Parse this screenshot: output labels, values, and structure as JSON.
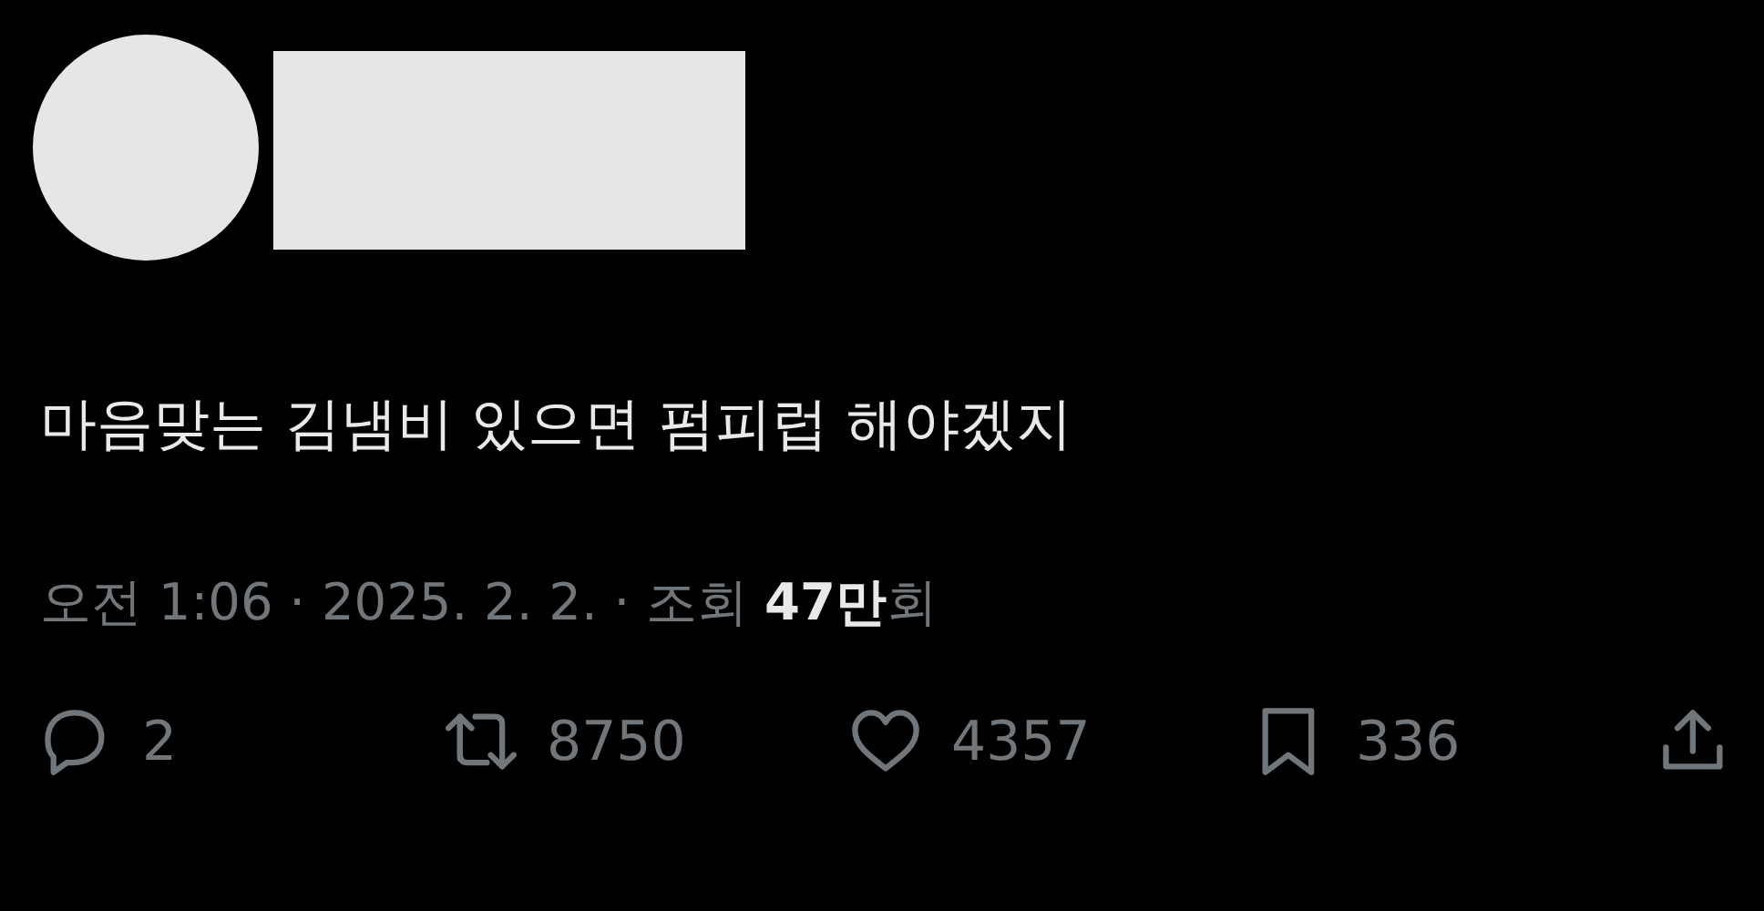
{
  "tweet": {
    "text": "마음맞는 김냄비 있으면 펌피럽 해야겠지",
    "meta": "오전 1:06 · 2025. 2. 2. · 조회 **47만**회",
    "actions": [
      {
        "kind": "reply",
        "count": "2"
      },
      {
        "kind": "retweet",
        "count": "8750"
      },
      {
        "kind": "like",
        "count": "4357"
      },
      {
        "kind": "bookmark",
        "count": "336"
      },
      {
        "kind": "share"
      }
    ]
  }
}
